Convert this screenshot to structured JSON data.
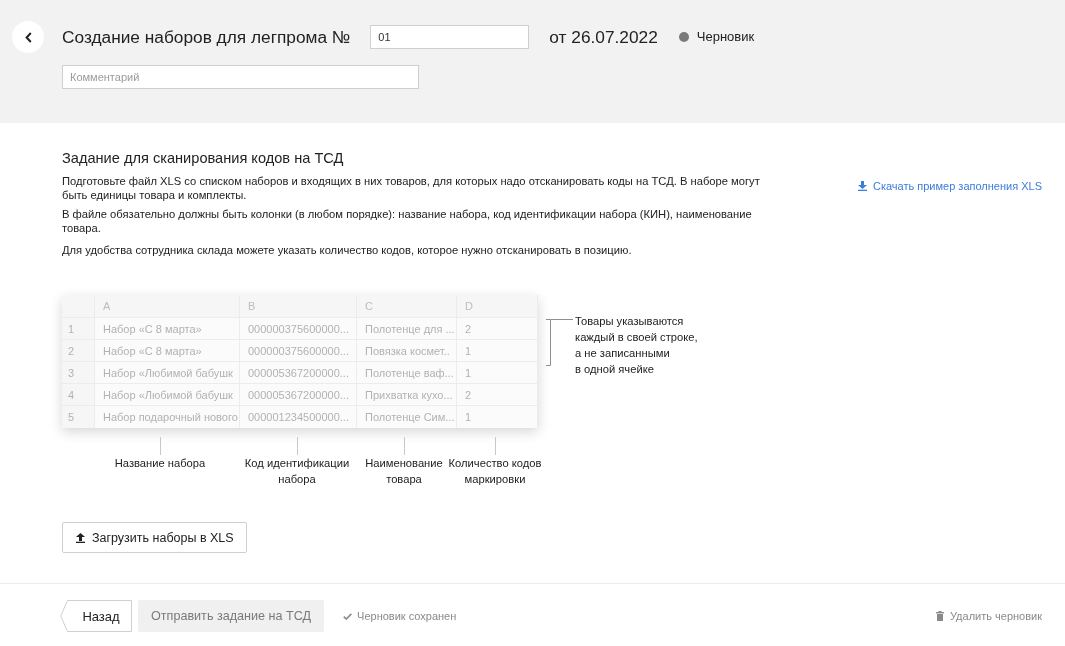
{
  "header": {
    "title": "Создание наборов для легпрома №",
    "number_field": {
      "value": "01"
    },
    "date": "от 26.07.2022",
    "status": "Черновик",
    "comment_field": {
      "placeholder": "Комментарий"
    }
  },
  "task": {
    "title": "Задание для сканирования кодов на ТСД",
    "paragraphs": [
      "Подготовьте файл XLS со списком наборов и входящих в них товаров, для которых надо отсканировать коды на ТСД. В наборе могут быть единицы товара и комплекты.",
      "В файле обязательно должны быть колонки (в любом порядке): название набора, код идентификации набора (КИН), наименование товара.",
      "Для удобства сотрудника склада можете указать количество кодов, которое нужно отсканировать в позицию."
    ],
    "download_link": "Скачать пример заполнения XLS"
  },
  "sample_sheet": {
    "columns": [
      "A",
      "B",
      "C",
      "D"
    ],
    "rows": [
      {
        "number": "1",
        "cells": [
          "Набор «С 8 марта»",
          "000000375600000...",
          "Полотенце для ...",
          "2"
        ]
      },
      {
        "number": "2",
        "cells": [
          "Набор «С 8 марта»",
          "000000375600000...",
          "Повязка космет..",
          "1"
        ]
      },
      {
        "number": "3",
        "cells": [
          "Набор «Любимой бабушк",
          "000005367200000...",
          "Полотенце ваф...",
          "1"
        ]
      },
      {
        "number": "4",
        "cells": [
          "Набор «Любимой бабушк",
          "000005367200000...",
          "Прихватка кухо...",
          "2"
        ]
      },
      {
        "number": "5",
        "cells": [
          "Набор подарочный нового",
          "000001234500000...",
          "Полотенце Сим...",
          "1"
        ]
      }
    ],
    "note": "Товары указываются\nкаждый в своей строке,\nа не записанными\nв одной ячейке",
    "column_notes": [
      "Название набора",
      "Код идентификации\nнабора",
      "Наименование\nтовара",
      "Количество кодов\nмаркировки"
    ]
  },
  "upload_button": "Загрузить наборы в XLS",
  "footer": {
    "back_button": "Назад",
    "send_button": {
      "label": "Отправить задание на ТСД",
      "disabled": true
    },
    "save_status": "Черновик сохранен",
    "delete_button": "Удалить черновик"
  }
}
